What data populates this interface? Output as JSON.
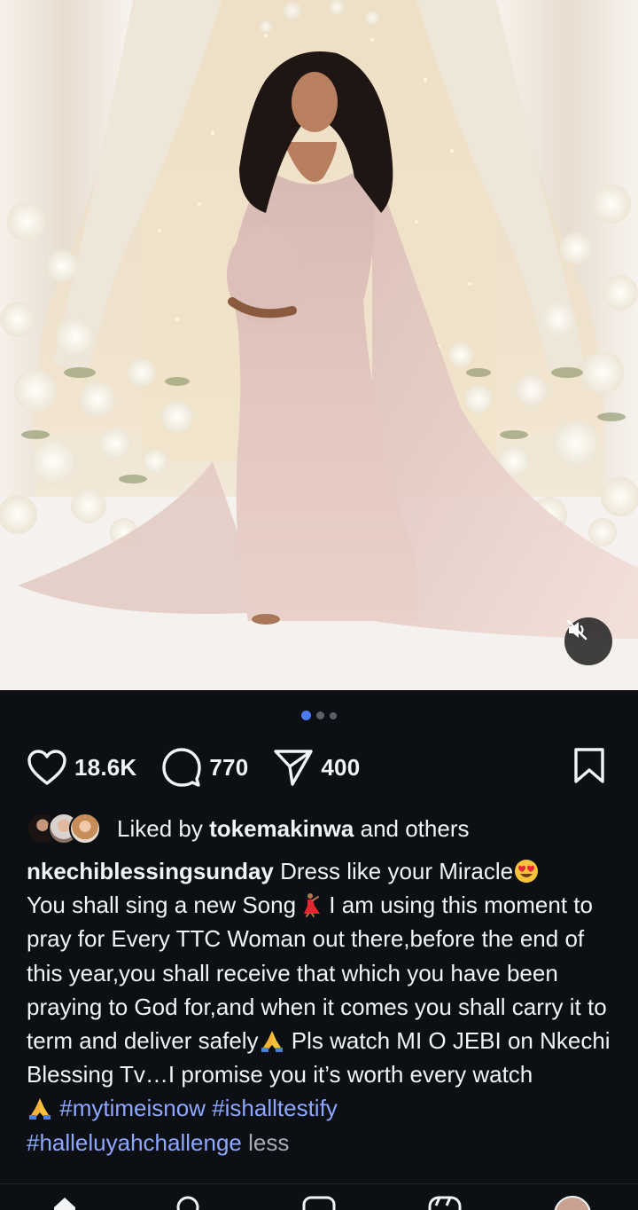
{
  "post": {
    "media": {
      "image_description_icon": "maternity-photo",
      "mute_icon": "speaker-muted-icon",
      "carousel": {
        "count": 3,
        "active_index": 0
      }
    },
    "actions": {
      "likes": "18.6K",
      "comments": "770",
      "shares": "400"
    },
    "liked_by": {
      "prefix": "Liked by",
      "user": "tokemakinwa",
      "suffix": "and others"
    },
    "caption": {
      "username": "nkechiblessingsunday",
      "seg1": "Dress like your Miracle",
      "seg2": "You shall sing a new Song",
      "seg3": "I am using this moment to pray for Every TTC Woman out there,before the end of this year,you shall receive that which you have been praying to God for,and when it comes you shall carry it to term and deliver safely",
      "seg4": "Pls watch MI O JEBI on Nkechi Blessing Tv…I promise you it’s worth every watch",
      "hashtags": [
        "#mytimeisnow",
        "#ishalltestify",
        "#halleluyahchallenge"
      ],
      "less": "less"
    }
  },
  "colors": {
    "background": "#0c0f14",
    "text": "#f1f3f5",
    "hashtag": "#8fa8ff",
    "active_dot": "#4a7cf5"
  },
  "bottom_nav": [
    "home-icon",
    "search-icon",
    "reels-icon",
    "shop-icon",
    "profile-avatar"
  ]
}
